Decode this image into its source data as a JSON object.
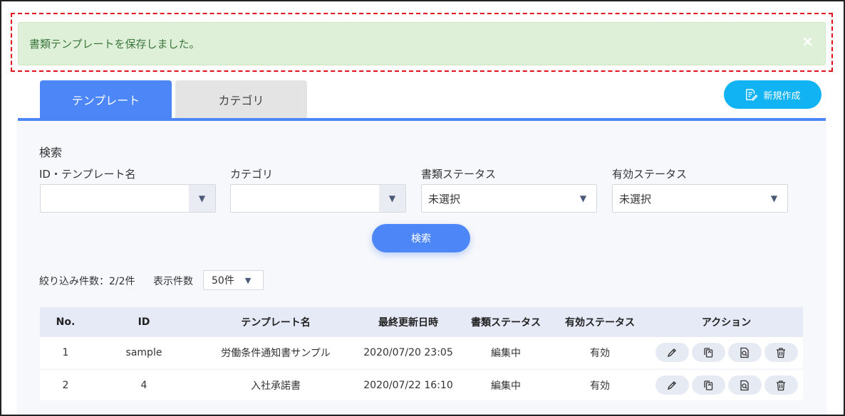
{
  "alert": {
    "message": "書類テンプレートを保存しました。",
    "close": "×"
  },
  "tabs": [
    {
      "label": "テンプレート",
      "active": true
    },
    {
      "label": "カテゴリ",
      "active": false
    }
  ],
  "new_button": {
    "label": "新規作成",
    "icon": "document-edit-icon"
  },
  "search": {
    "title": "検索",
    "fields": [
      {
        "label": "ID・テンプレート名",
        "value": ""
      },
      {
        "label": "カテゴリ",
        "value": ""
      },
      {
        "label": "書類ステータス",
        "value": "未選択"
      },
      {
        "label": "有効ステータス",
        "value": "未選択"
      }
    ],
    "button_label": "検索"
  },
  "filter": {
    "count_text": "絞り込み件数：2/2件",
    "per_page_label": "表示件数",
    "per_page_value": "50件"
  },
  "table": {
    "headers": [
      "No.",
      "ID",
      "テンプレート名",
      "最終更新日時",
      "書類ステータス",
      "有効ステータス",
      "アクション"
    ],
    "rows": [
      {
        "no": "1",
        "id": "sample",
        "name": "労働条件通知書サンプル",
        "updated": "2020/07/20 23:05",
        "doc_status": "編集中",
        "active_status": "有効"
      },
      {
        "no": "2",
        "id": "4",
        "name": "入社承諾書",
        "updated": "2020/07/22 16:10",
        "doc_status": "編集中",
        "active_status": "有効"
      }
    ],
    "action_icons": [
      "pencil-icon",
      "copy-icon",
      "preview-icon",
      "trash-icon"
    ]
  },
  "colors": {
    "primary": "#4c86f7",
    "new_button": "#11b3f2",
    "alert_bg": "#dff0d8",
    "alert_text": "#3c763d",
    "highlight": "#e0101c"
  }
}
